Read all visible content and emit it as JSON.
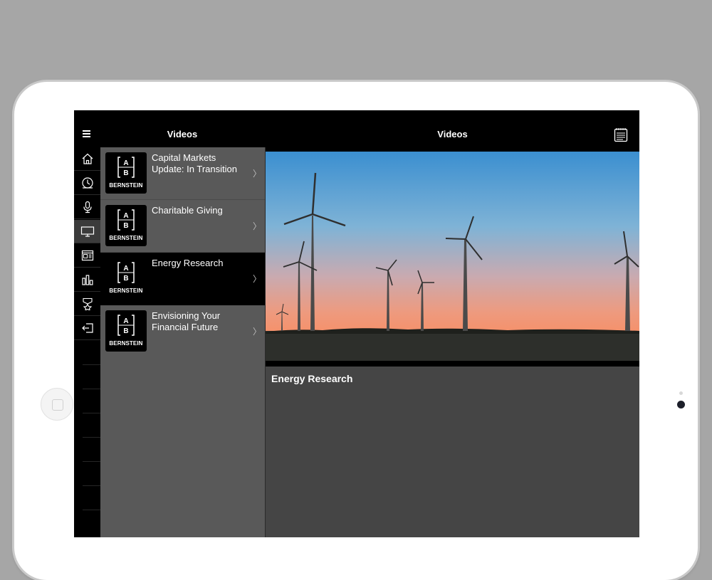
{
  "header": {
    "list_title": "Videos",
    "detail_title": "Videos"
  },
  "icons": {
    "menu": "hamburger-menu-icon",
    "notes": "notepad-icon",
    "chevron": "chevron-right-icon"
  },
  "rail": [
    {
      "name": "home-icon",
      "active": false
    },
    {
      "name": "clock-icon",
      "active": false
    },
    {
      "name": "microphone-icon",
      "active": false
    },
    {
      "name": "monitor-icon",
      "active": true
    },
    {
      "name": "newspaper-icon",
      "active": false
    },
    {
      "name": "bar-chart-icon",
      "active": false
    },
    {
      "name": "award-ribbon-icon",
      "active": false
    },
    {
      "name": "logout-icon",
      "active": false
    }
  ],
  "videos": [
    {
      "title": "Capital Markets Update: In Transition",
      "brand": "BERNSTEIN",
      "logo": "[A|B]",
      "selected": false
    },
    {
      "title": "Charitable Giving",
      "brand": "BERNSTEIN",
      "logo": "[A|B]",
      "selected": false
    },
    {
      "title": "Energy Research",
      "brand": "BERNSTEIN",
      "logo": "[A|B]",
      "selected": true
    },
    {
      "title": "Envisioning Your Financial Future",
      "brand": "BERNSTEIN",
      "logo": "[A|B]",
      "selected": false
    }
  ],
  "detail": {
    "heading": "Energy Research"
  },
  "colors": {
    "accent_battery": "#4cd964",
    "list_bg": "#595959",
    "detail_bg": "#454545",
    "selected_bg": "#000000"
  }
}
